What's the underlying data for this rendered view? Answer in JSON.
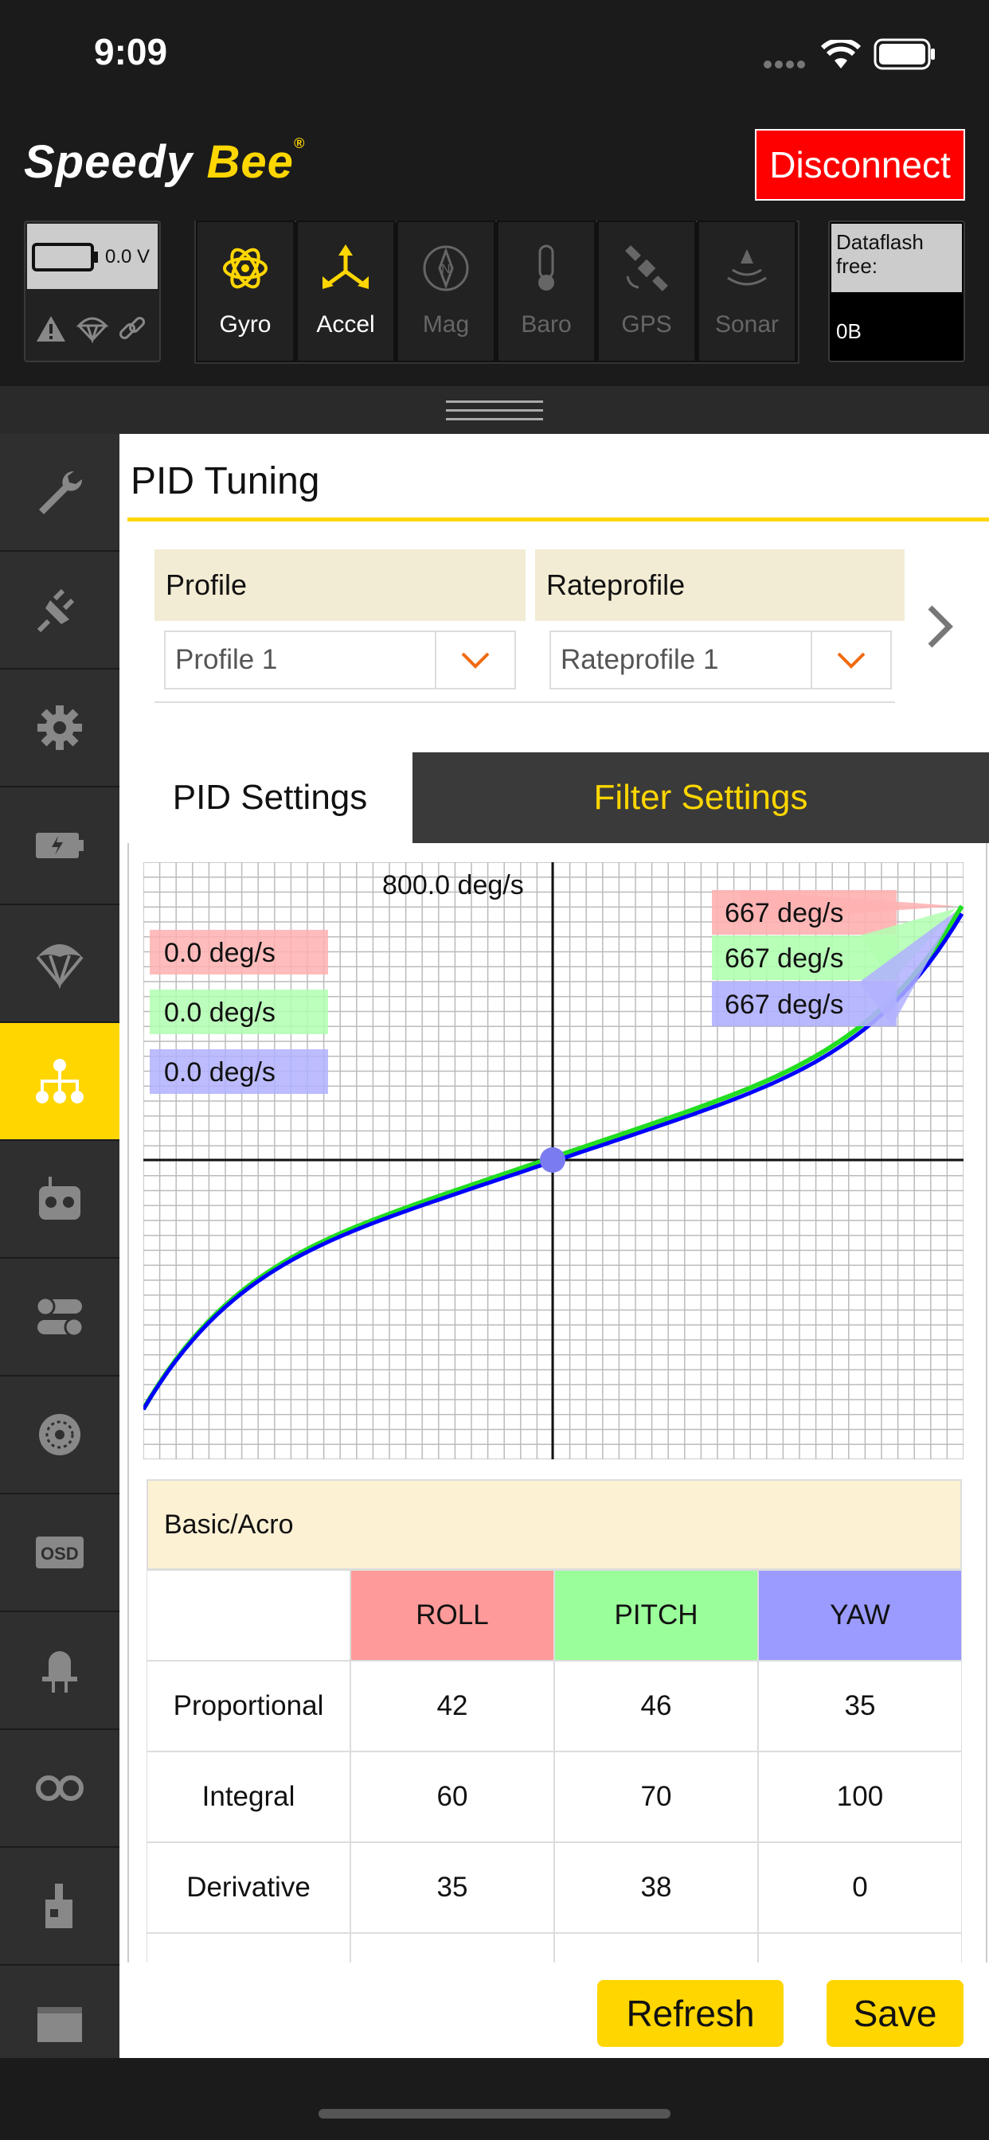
{
  "status": {
    "time": "9:09"
  },
  "header": {
    "logo_part1": "Speedy",
    "logo_part2": "Bee",
    "logo_reg": "®",
    "disconnect_label": "Disconnect",
    "battery_voltage": "0.0 V",
    "sensors": [
      {
        "label": "Gyro",
        "icon": "gyro-icon",
        "active": true
      },
      {
        "label": "Accel",
        "icon": "accel-icon",
        "active": true
      },
      {
        "label": "Mag",
        "icon": "compass-icon",
        "active": false
      },
      {
        "label": "Baro",
        "icon": "thermometer-icon",
        "active": false
      },
      {
        "label": "GPS",
        "icon": "satellite-icon",
        "active": false
      },
      {
        "label": "Sonar",
        "icon": "sonar-icon",
        "active": false
      }
    ],
    "dataflash_label": "Dataflash free:",
    "dataflash_value": "0B"
  },
  "page": {
    "title": "PID Tuning",
    "profile_label": "Profile",
    "profile_value": "Profile 1",
    "rateprofile_label": "Rateprofile",
    "rateprofile_value": "Rateprofile 1",
    "tabs": [
      {
        "label": "PID Settings",
        "active": true
      },
      {
        "label": "Filter Settings",
        "active": false
      }
    ]
  },
  "graph": {
    "max_label": "800.0 deg/s",
    "left_labels": [
      "0.0 deg/s",
      "0.0 deg/s",
      "0.0 deg/s"
    ],
    "right_labels": [
      "667 deg/s",
      "667 deg/s",
      "667 deg/s"
    ],
    "colors": {
      "roll": "#ffa0a0",
      "pitch": "#9aff9a",
      "yaw": "#9a9aff",
      "curve_green": "#22dd22",
      "curve_blue": "#0000ff"
    }
  },
  "pid_table": {
    "section": "Basic/Acro",
    "columns": [
      "ROLL",
      "PITCH",
      "YAW"
    ],
    "rows": [
      {
        "name": "Proportional",
        "values": [
          "42",
          "46",
          "35"
        ]
      },
      {
        "name": "Integral",
        "values": [
          "60",
          "70",
          "100"
        ]
      },
      {
        "name": "Derivative",
        "values": [
          "35",
          "38",
          "0"
        ]
      }
    ]
  },
  "actions": {
    "refresh": "Refresh",
    "save": "Save"
  },
  "colors": {
    "accent": "#ffd600",
    "danger": "#ff0000",
    "dark_bg": "#1b1b1b"
  }
}
